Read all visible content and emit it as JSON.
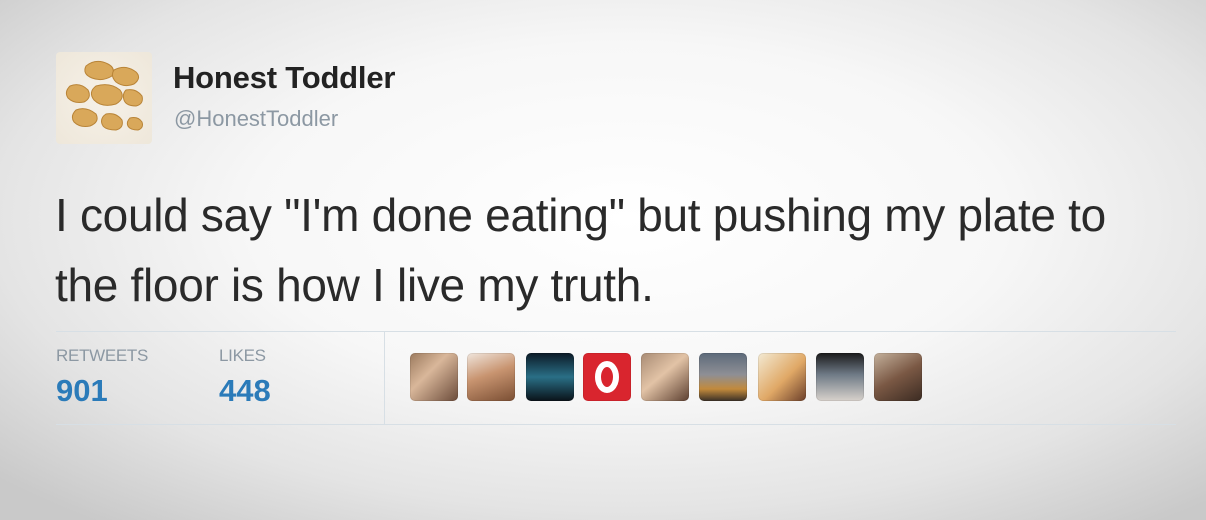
{
  "tweet": {
    "display_name": "Honest Toddler",
    "handle": "@HonestToddler",
    "text": "I could say \"I'm done eating\" but pushing my plate to the floor is how I live my truth."
  },
  "stats": {
    "retweets_label": "RETWEETS",
    "retweets_value": "901",
    "likes_label": "LIKES",
    "likes_value": "448"
  },
  "likers": [
    {
      "name": "liker-avatar-1"
    },
    {
      "name": "liker-avatar-2"
    },
    {
      "name": "liker-avatar-3"
    },
    {
      "name": "liker-avatar-4"
    },
    {
      "name": "liker-avatar-5"
    },
    {
      "name": "liker-avatar-6"
    },
    {
      "name": "liker-avatar-7"
    },
    {
      "name": "liker-avatar-8"
    },
    {
      "name": "liker-avatar-9"
    }
  ],
  "colors": {
    "link_blue": "#2b7bb9",
    "muted_gray": "#8c98a3",
    "text_dark": "#2a2a2a"
  }
}
